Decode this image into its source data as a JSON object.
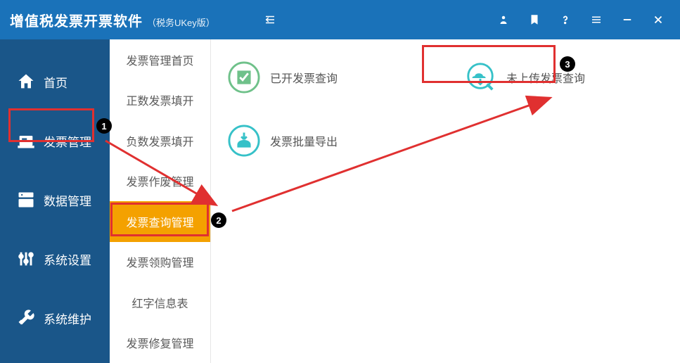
{
  "titlebar": {
    "title": "增值税发票开票软件",
    "subtitle": "（税务UKey版）"
  },
  "sidebar": {
    "items": [
      {
        "label": "首页"
      },
      {
        "label": "发票管理"
      },
      {
        "label": "数据管理"
      },
      {
        "label": "系统设置"
      },
      {
        "label": "系统维护"
      }
    ]
  },
  "submenu": {
    "items": [
      {
        "label": "发票管理首页"
      },
      {
        "label": "正数发票填开"
      },
      {
        "label": "负数发票填开"
      },
      {
        "label": "发票作废管理"
      },
      {
        "label": "发票查询管理",
        "active": true
      },
      {
        "label": "发票领购管理"
      },
      {
        "label": "红字信息表"
      },
      {
        "label": "发票修复管理"
      }
    ]
  },
  "content": {
    "functions": [
      {
        "label": "已开发票查询",
        "icon": "check-doc-icon"
      },
      {
        "label": "未上传发票查询",
        "icon": "cloud-upload-icon"
      },
      {
        "label": "发票批量导出",
        "icon": "export-icon"
      }
    ]
  },
  "annotations": {
    "step1": "1",
    "step2": "2",
    "step3": "3"
  },
  "colors": {
    "header": "#1a72b9",
    "sidebar": "#1a5689",
    "accent": "#f4a100",
    "iconGreen": "#6fc18a",
    "iconCyan": "#36c1c8",
    "highlight": "#e03030"
  }
}
